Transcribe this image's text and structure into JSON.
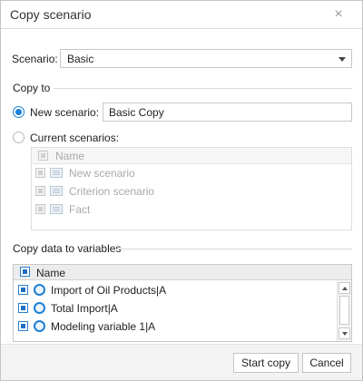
{
  "dialog": {
    "title": "Copy scenario",
    "close_glyph": "×"
  },
  "scenario": {
    "label": "Scenario:",
    "selected": "Basic"
  },
  "copy_to": {
    "section_label": "Copy to",
    "new_scenario": {
      "label": "New scenario:",
      "value": "Basic Copy",
      "selected": true
    },
    "current_scenarios": {
      "label": "Current scenarios:",
      "selected": false,
      "header": "Name",
      "items": [
        {
          "label": "New scenario",
          "icon": "scenario-icon"
        },
        {
          "label": "Criterion scenario",
          "icon": "scenario-icon"
        },
        {
          "label": "Fact",
          "icon": "scenario-icon"
        }
      ]
    }
  },
  "variables": {
    "section_label": "Copy data to variables",
    "header": "Name",
    "items": [
      {
        "label": "Import of Oil Products|A",
        "checked": true,
        "icon": "variable-icon"
      },
      {
        "label": "Total Import|A",
        "checked": true,
        "icon": "variable-icon"
      },
      {
        "label": "Modeling variable 1|A",
        "checked": true,
        "icon": "variable-icon"
      }
    ]
  },
  "footer": {
    "start_copy": "Start copy",
    "cancel": "Cancel"
  },
  "colors": {
    "accent": "#1a7fd6",
    "disabled_text": "#a9a9a9"
  }
}
